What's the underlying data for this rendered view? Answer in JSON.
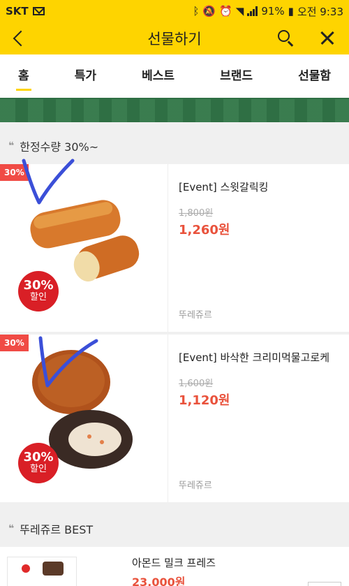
{
  "status": {
    "carrier": "SKT",
    "battery": "91%",
    "time": "오전 9:33"
  },
  "header": {
    "title": "선물하기"
  },
  "tabs": [
    {
      "label": "홈",
      "active": true
    },
    {
      "label": "특가"
    },
    {
      "label": "베스트"
    },
    {
      "label": "브랜드"
    },
    {
      "label": "선물함"
    }
  ],
  "sections": {
    "limited": {
      "title": "한정수량 30%~"
    },
    "best": {
      "title": "뚜레쥬르 BEST"
    }
  },
  "products": [
    {
      "tag": "30%",
      "badge_line1": "30%",
      "badge_line2": "할인",
      "name": "[Event] 스윗갈릭킹",
      "old_price": "1,800원",
      "price": "1,260원",
      "brand": "뚜레쥬르"
    },
    {
      "tag": "30%",
      "badge_line1": "30%",
      "badge_line2": "할인",
      "name": "[Event] 바삭한 크리미먹물고로케",
      "old_price": "1,600원",
      "price": "1,120원",
      "brand": "뚜레쥬르"
    }
  ],
  "best_products": [
    {
      "name": "아몬드 밀크 프레즈",
      "price": "23,000원"
    }
  ],
  "colors": {
    "accent": "#fed400",
    "sale": "#e9523c",
    "badge": "#d91f26",
    "annotation": "#3b4fd8"
  }
}
